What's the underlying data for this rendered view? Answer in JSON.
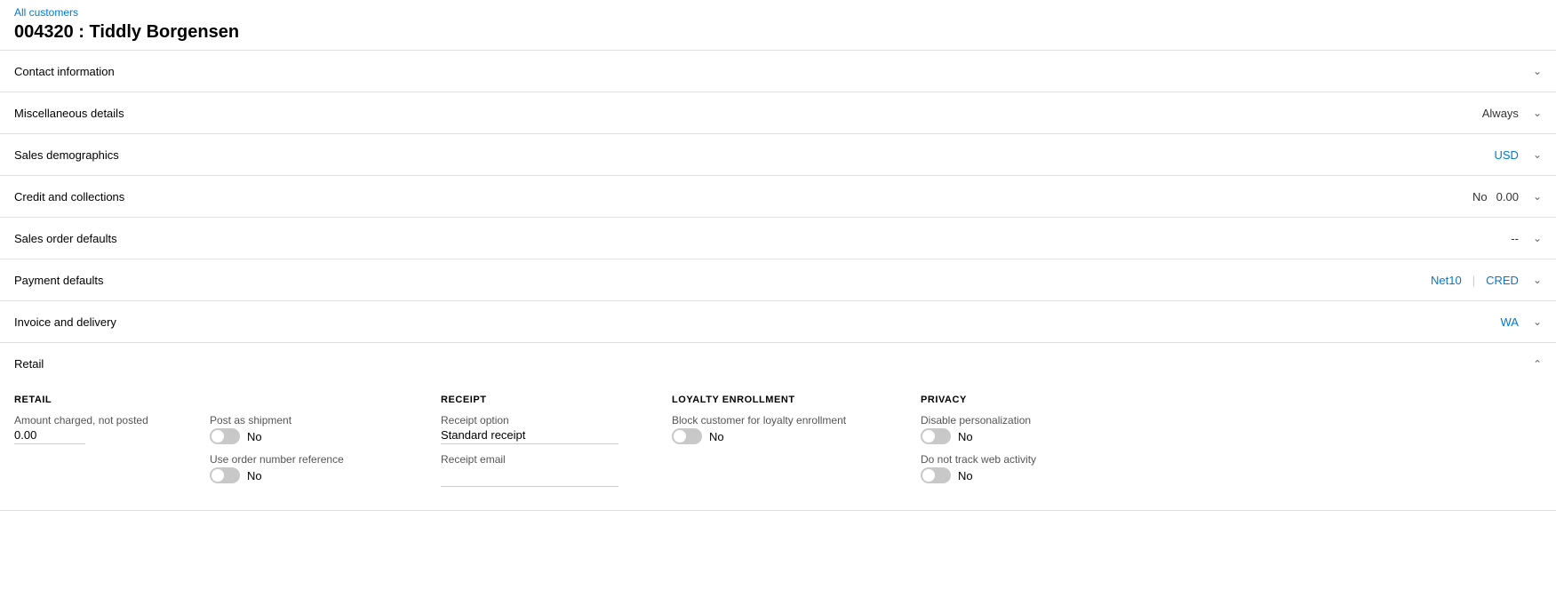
{
  "breadcrumb": {
    "text": "All customers"
  },
  "page_title": "004320 : Tiddly Borgensen",
  "sections": [
    {
      "id": "contact-information",
      "title": "Contact information",
      "expanded": false,
      "meta_values": []
    },
    {
      "id": "miscellaneous-details",
      "title": "Miscellaneous details",
      "expanded": false,
      "meta_values": [
        {
          "text": "Always",
          "blue": false
        }
      ]
    },
    {
      "id": "sales-demographics",
      "title": "Sales demographics",
      "expanded": false,
      "meta_values": [
        {
          "text": "USD",
          "blue": true
        }
      ]
    },
    {
      "id": "credit-and-collections",
      "title": "Credit and collections",
      "expanded": false,
      "meta_values": [
        {
          "text": "No",
          "blue": false
        },
        {
          "text": "0.00",
          "blue": false
        }
      ]
    },
    {
      "id": "sales-order-defaults",
      "title": "Sales order defaults",
      "expanded": false,
      "meta_values": [
        {
          "text": "--",
          "blue": false
        }
      ]
    },
    {
      "id": "payment-defaults",
      "title": "Payment defaults",
      "expanded": false,
      "meta_values": [
        {
          "text": "Net10",
          "blue": true
        },
        {
          "text": "CRED",
          "blue": true
        }
      ]
    },
    {
      "id": "invoice-and-delivery",
      "title": "Invoice and delivery",
      "expanded": false,
      "meta_values": [
        {
          "text": "WA",
          "blue": true
        }
      ]
    },
    {
      "id": "retail",
      "title": "Retail",
      "expanded": true,
      "meta_values": []
    }
  ],
  "retail": {
    "col1": {
      "header": "RETAIL",
      "amount_label": "Amount charged, not posted",
      "amount_value": "0.00"
    },
    "col2": {
      "post_as_shipment_label": "Post as shipment",
      "post_as_shipment_value": "No",
      "use_order_number_label": "Use order number reference",
      "use_order_number_value": "No"
    },
    "col3": {
      "header": "RECEIPT",
      "receipt_option_label": "Receipt option",
      "receipt_option_value": "Standard receipt",
      "receipt_email_label": "Receipt email",
      "receipt_email_value": ""
    },
    "col4": {
      "header": "LOYALTY ENROLLMENT",
      "block_customer_label": "Block customer for loyalty enrollment",
      "block_customer_value": "No"
    },
    "col5": {
      "header": "PRIVACY",
      "disable_personalization_label": "Disable personalization",
      "disable_personalization_value": "No",
      "do_not_track_label": "Do not track web activity",
      "do_not_track_value": "No"
    }
  }
}
